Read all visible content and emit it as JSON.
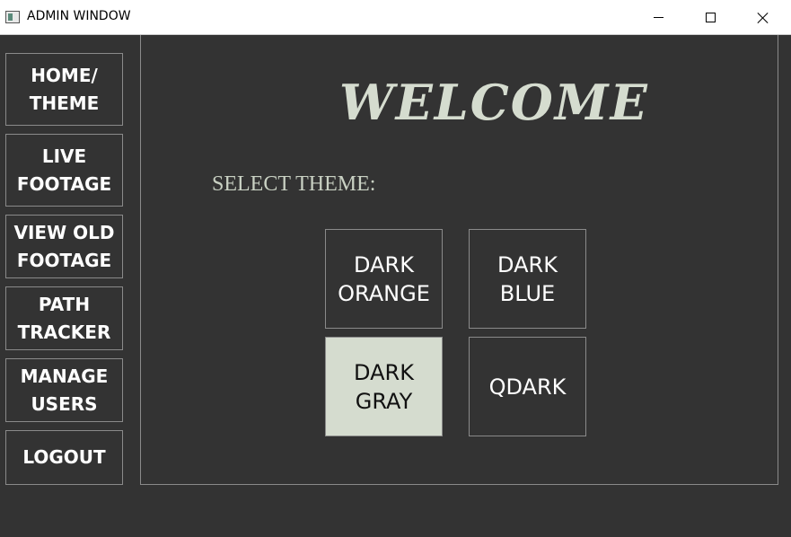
{
  "window": {
    "title": "ADMIN WINDOW",
    "controls": [
      "minimize",
      "maximize",
      "close"
    ]
  },
  "sidebar": {
    "items": [
      {
        "label": "HOME/\nTHEME"
      },
      {
        "label": "LIVE\nFOOTAGE"
      },
      {
        "label": "VIEW OLD\nFOOTAGE"
      },
      {
        "label": "PATH\nTRACKER"
      },
      {
        "label": "MANAGE\nUSERS"
      },
      {
        "label": "LOGOUT"
      }
    ]
  },
  "main": {
    "heading": "WELCOME",
    "select_label": "SELECT THEME:",
    "themes": [
      {
        "label": "DARK\nORANGE",
        "selected": false
      },
      {
        "label": "DARK\nBLUE",
        "selected": false
      },
      {
        "label": "DARK\nGRAY",
        "selected": true
      },
      {
        "label": "QDARK",
        "selected": false
      }
    ]
  },
  "colors": {
    "background": "#333333",
    "accent_text": "#d5dccf",
    "border": "#8a8a8a",
    "selected_theme_bg": "#d5dccf"
  }
}
